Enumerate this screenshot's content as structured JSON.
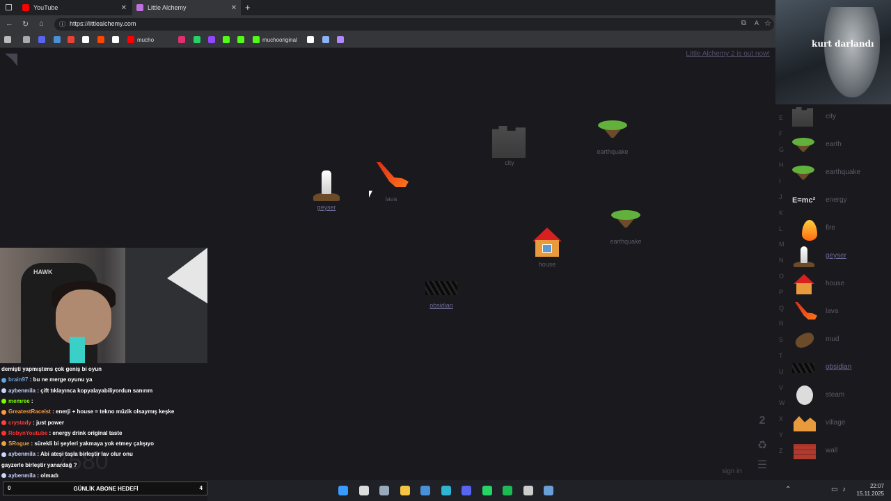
{
  "browser": {
    "tabs": [
      {
        "label": "YouTube",
        "color": "#ff0000"
      },
      {
        "label": "Little Alchemy",
        "color": "#9b59b6"
      }
    ],
    "new_tab": "+",
    "close": "✕",
    "url": "https://littlealchemy.com",
    "bookmarks": [
      {
        "label": "",
        "icon": "gamepad-icon",
        "color": "#bbbbbb"
      },
      {
        "label": "",
        "icon": "image-icon",
        "color": "#aaaaaa"
      },
      {
        "label": "",
        "icon": "discord-icon",
        "color": "#5865f2"
      },
      {
        "label": "",
        "icon": "bookmark-blue-icon",
        "color": "#4a90d9"
      },
      {
        "label": "",
        "icon": "gmail-icon",
        "color": "#ea4335"
      },
      {
        "label": "",
        "icon": "google-icon",
        "color": "#ffffff"
      },
      {
        "label": "",
        "icon": "reddit-icon",
        "color": "#ff4500"
      },
      {
        "label": "",
        "icon": "x-icon",
        "color": "#ffffff"
      },
      {
        "label": "mucho",
        "icon": "youtube-icon",
        "color": "#ff0000"
      },
      {
        "label": "",
        "icon": "instagram-icon",
        "color": "#e1306c"
      },
      {
        "label": "",
        "icon": "whatsapp-icon",
        "color": "#25d366"
      },
      {
        "label": "",
        "icon": "twitch-icon",
        "color": "#9146ff"
      },
      {
        "label": "",
        "icon": "kick-green-icon",
        "color": "#53fc18"
      },
      {
        "label": "",
        "icon": "kick-icon",
        "color": "#53fc18"
      },
      {
        "label": "muchooriginal",
        "icon": "kick-icon",
        "color": "#53fc18"
      },
      {
        "label": "",
        "icon": "openai-icon",
        "color": "#ffffff"
      },
      {
        "label": "",
        "icon": "cycle-icon",
        "color": "#8ab4f8"
      },
      {
        "label": "",
        "icon": "pen-icon",
        "color": "#b388ff"
      }
    ]
  },
  "game": {
    "promo": "Little Alchemy 2 is out now!",
    "workspace": [
      {
        "name": "earthquake",
        "icon": "earthquake",
        "underline": false
      },
      {
        "name": "city",
        "icon": "city",
        "underline": false
      },
      {
        "name": "geyser",
        "icon": "geyser",
        "underline": true
      },
      {
        "name": "lava",
        "icon": "lava",
        "underline": false
      },
      {
        "name": "earthquake",
        "icon": "earthquake",
        "underline": false
      },
      {
        "name": "house",
        "icon": "house",
        "underline": false
      },
      {
        "name": "obsidian",
        "icon": "obsidian",
        "underline": true
      }
    ],
    "letters": [
      "E",
      "F",
      "G",
      "H",
      "I",
      "J",
      "K",
      "L",
      "M",
      "N",
      "O",
      "P",
      "Q",
      "R",
      "S",
      "T",
      "U",
      "V",
      "W",
      "X",
      "Y",
      "Z"
    ],
    "library": [
      {
        "name": "city",
        "icon": "city",
        "underline": false
      },
      {
        "name": "earth",
        "icon": "earth",
        "underline": false
      },
      {
        "name": "earthquake",
        "icon": "earth",
        "underline": false
      },
      {
        "name": "energy",
        "icon": "energy",
        "underline": false,
        "icon_text": "E=mc²"
      },
      {
        "name": "fire",
        "icon": "fire",
        "underline": false
      },
      {
        "name": "geyser",
        "icon": "geyser",
        "underline": true
      },
      {
        "name": "house",
        "icon": "house",
        "underline": false
      },
      {
        "name": "lava",
        "icon": "lava",
        "underline": false
      },
      {
        "name": "mud",
        "icon": "mud",
        "underline": false
      },
      {
        "name": "obsidian",
        "icon": "obsidian",
        "underline": true
      },
      {
        "name": "steam",
        "icon": "steam",
        "underline": false
      },
      {
        "name": "village",
        "icon": "village",
        "underline": false
      },
      {
        "name": "wall",
        "icon": "wall",
        "underline": false
      }
    ],
    "sign_in": "sign in"
  },
  "overlay": {
    "wolf_title": "kurt darlandı",
    "chair_text": "HAWK",
    "chat": [
      {
        "user": "",
        "text": "demişti yapmıştıms çok geniş bi oyun",
        "color": "#ffffff"
      },
      {
        "user": "brain97",
        "text": " : bu ne merge oyunu ya",
        "color": "#6aa0d8"
      },
      {
        "user": "aybenmila",
        "text": " : çift tıklayınca kopyalayabiliyordun sanırım",
        "color": "#c8d6ff"
      },
      {
        "user": "memree",
        "text": " :",
        "color": "#7cfc00"
      },
      {
        "user": "GreatestRaceist",
        "text": " : enerji + house = tekno müzik olsaymış keşke",
        "color": "#ff9a3c"
      },
      {
        "user": "crystady",
        "text": " : just power",
        "color": "#ff4040"
      },
      {
        "user": "RobynYoutube",
        "text": " : energy drink original taste",
        "color": "#ff3030"
      },
      {
        "user": "SRogue",
        "text": " : sürekli bi şeyleri yakmaya yok etmey çalışıyo",
        "color": "#e8a040"
      },
      {
        "user": "aybenmila",
        "text": " : Abi ateşi taşla birleştir lav olur onu",
        "color": "#c8d6ff"
      },
      {
        "user": "",
        "text": "gayzerle birleştir yanardağ ?",
        "color": "#ffffff"
      },
      {
        "user": "aybenmila",
        "text": " : olmadı",
        "color": "#c8d6ff"
      }
    ],
    "goal_left": "0",
    "goal_title": "GÜNLİK ABONE HEDEFİ",
    "goal_right": "4",
    "watermark": "7580"
  },
  "taskbar": {
    "time": "22:07",
    "date": "15.11.2025",
    "apps": [
      {
        "name": "windows-start-icon",
        "color": "#3a9bff"
      },
      {
        "name": "search-icon",
        "color": "#dddddd"
      },
      {
        "name": "steam-icon",
        "color": "#9ab"
      },
      {
        "name": "file-explorer-icon",
        "color": "#f5c542"
      },
      {
        "name": "store-icon",
        "color": "#4a90d9"
      },
      {
        "name": "edge-icon",
        "color": "#2fb5d2"
      },
      {
        "name": "discord-icon",
        "color": "#5865f2"
      },
      {
        "name": "whatsapp-icon",
        "color": "#25d366"
      },
      {
        "name": "spotify-icon",
        "color": "#1db954"
      },
      {
        "name": "obs-icon",
        "color": "#cccccc"
      },
      {
        "name": "app-icon",
        "color": "#6aa0d8"
      }
    ]
  }
}
